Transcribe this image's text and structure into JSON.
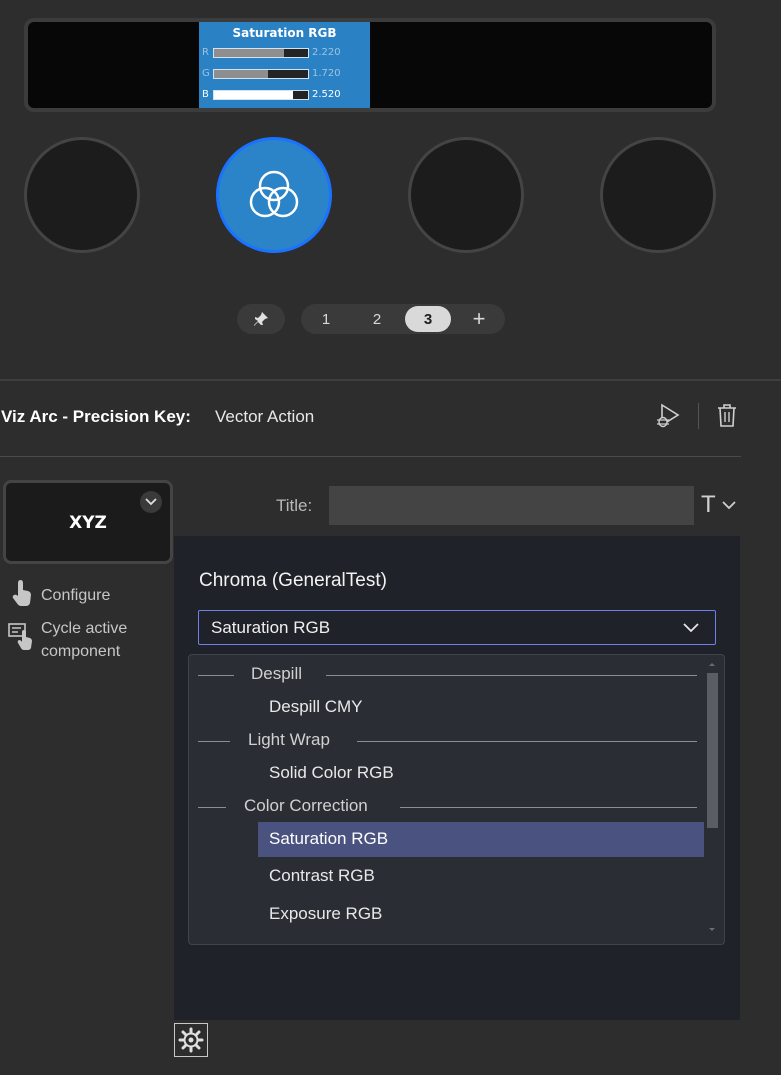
{
  "lcd": {
    "title": "Saturation RGB",
    "rows": [
      {
        "label": "R",
        "value": "2.220",
        "fill": 0.74,
        "active": false
      },
      {
        "label": "G",
        "value": "1.720",
        "fill": 0.57,
        "active": false
      },
      {
        "label": "B",
        "value": "2.520",
        "fill": 0.84,
        "active": true
      }
    ]
  },
  "pages": {
    "items": [
      "1",
      "2",
      "3"
    ],
    "selected": "3",
    "add_label": "+"
  },
  "header": {
    "app": "Viz Arc - Precision Key:",
    "action": "Vector Action"
  },
  "key": {
    "label": "XYZ"
  },
  "side_actions": {
    "configure": "Configure",
    "cycle_line1": "Cycle active",
    "cycle_line2": "component"
  },
  "title_field": {
    "label": "Title:",
    "value": "",
    "format_glyph": "T"
  },
  "component": {
    "title": "Chroma (GeneralTest)",
    "selected": "Saturation RGB"
  },
  "dropdown": {
    "groups": [
      {
        "label": "Despill",
        "items": [
          "Despill CMY"
        ]
      },
      {
        "label": "Light Wrap",
        "items": [
          "Solid Color RGB"
        ]
      },
      {
        "label": "Color Correction",
        "items": [
          "Saturation RGB",
          "Contrast RGB",
          "Exposure RGB"
        ]
      }
    ]
  },
  "colors": {
    "accent": "#2b84c7",
    "ring": "#1a73ff",
    "highlight": "#4a5380",
    "select_border": "#6f7fe8"
  }
}
